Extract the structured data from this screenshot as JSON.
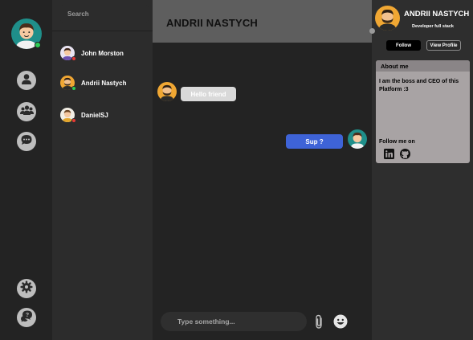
{
  "sidebar": {
    "user_status": "online",
    "icons": [
      "profile-icon",
      "group-icon",
      "chat-bubble-icon",
      "settings-gear-icon",
      "help-chat-icon"
    ]
  },
  "contacts": {
    "search_placeholder": "Search",
    "items": [
      {
        "name": "John Morston",
        "status_color": "#e53935"
      },
      {
        "name": "Andrii Nastych",
        "status_color": "#2ecc55"
      },
      {
        "name": "DanielSJ",
        "status_color": "#e53935"
      }
    ]
  },
  "chat": {
    "title": "ANDRII NASTYCH",
    "messages": [
      {
        "direction": "incoming",
        "text": "Hello friend"
      },
      {
        "direction": "outgoing",
        "text": "Sup ?"
      }
    ],
    "composer_placeholder": "Type something...",
    "outgoing_color": "#3e63d7",
    "incoming_color": "#d9d9d9"
  },
  "profile": {
    "name": "ANDRII NASTYCH",
    "role": "Developer full stack",
    "follow_label": "Follow",
    "view_profile_label": "View Profile",
    "about_title": "About me",
    "about_text": "I am the boss and CEO of this Platform :3",
    "follow_me_label": "Follow me on",
    "socials": [
      "linkedin-icon",
      "github-icon"
    ]
  }
}
